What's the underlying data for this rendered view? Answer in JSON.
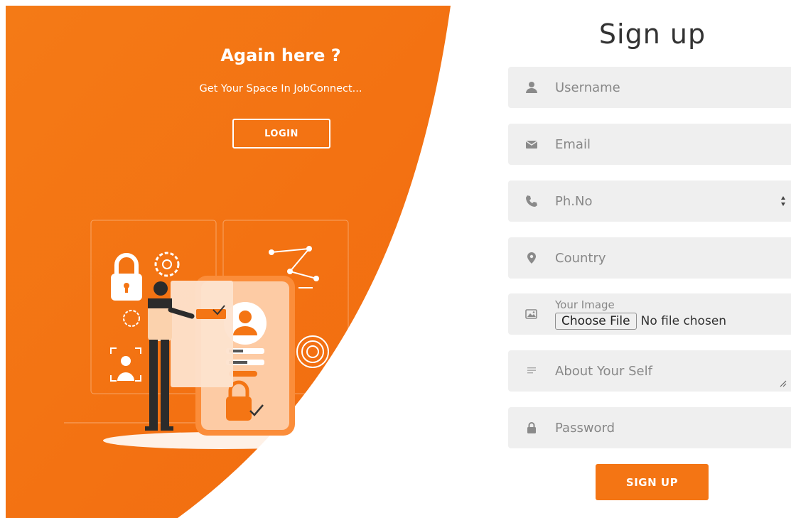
{
  "colors": {
    "accent": "#f47514",
    "accent_dark": "#f17012",
    "field_bg": "#efefef"
  },
  "left": {
    "heading": "Again here ?",
    "subtitle": "Get Your Space In JobConnect...",
    "login_label": "LOGIN"
  },
  "form": {
    "title": "Sign up",
    "username": {
      "icon": "user-icon",
      "placeholder": "Username"
    },
    "email": {
      "icon": "envelope-icon",
      "placeholder": "Email"
    },
    "phone": {
      "icon": "phone-icon",
      "placeholder": "Ph.No"
    },
    "country": {
      "icon": "map-marker-icon",
      "placeholder": "Country"
    },
    "image": {
      "icon": "image-icon",
      "label": "Your Image",
      "choose_label": "Choose File",
      "no_file_text": "No file chosen"
    },
    "about": {
      "icon": "lines-icon",
      "placeholder": "About Your Self"
    },
    "password": {
      "icon": "lock-icon",
      "placeholder": "Password"
    },
    "submit_label": "SIGN UP"
  }
}
